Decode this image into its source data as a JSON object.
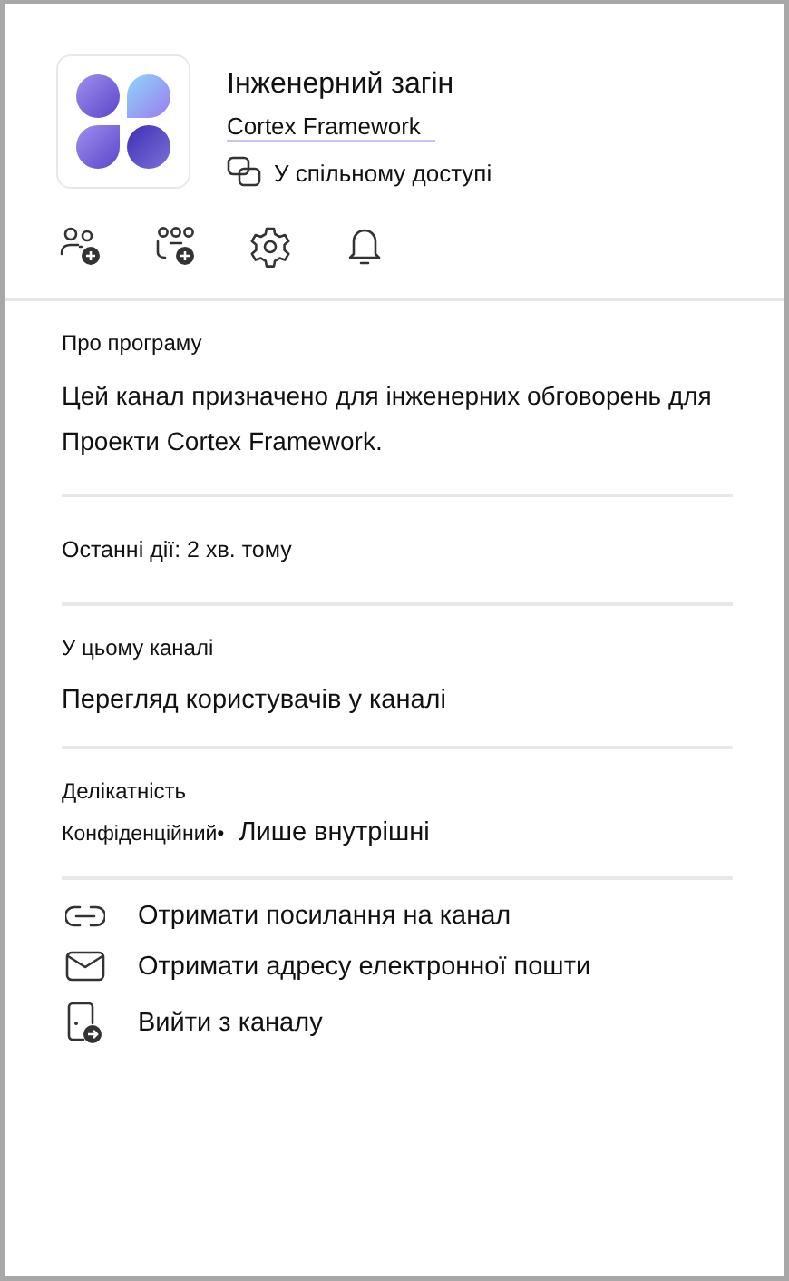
{
  "header": {
    "title": "Інженерний загін",
    "subtitle": "Cortex Framework",
    "sharing": "У спільному доступі"
  },
  "toolbar": [
    {
      "kind": "add-person"
    },
    {
      "kind": "add-team"
    },
    {
      "kind": "settings"
    },
    {
      "kind": "bell"
    }
  ],
  "about": {
    "heading": "Про програму",
    "text": "Цей канал призначено для інженерних обговорень для Проекти Cortex Framework."
  },
  "activity": "Останні дії: 2 хв. тому",
  "in_channel": {
    "heading": "У цьому каналі",
    "link": "Перегляд користувачів у каналі"
  },
  "sensitivity": {
    "heading": "Делікатність",
    "label": "Конфіденційний•",
    "value": "Лише внутрішні"
  },
  "actions": [
    {
      "kind": "link",
      "label": "Отримати посилання на канал"
    },
    {
      "kind": "mail",
      "label": "Отримати адресу електронної пошти"
    },
    {
      "kind": "leave",
      "label": "Вийти з каналу"
    }
  ]
}
